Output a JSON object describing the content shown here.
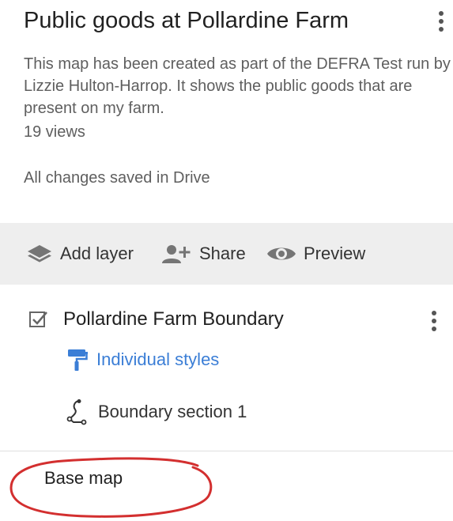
{
  "map": {
    "title": "Public goods at Pollardine Farm",
    "description": "This map has been created as part of the DEFRA Test run by Lizzie Hulton-Harrop. It shows the public goods that are present on my farm.",
    "views": "19 views",
    "save_status": "All changes saved in Drive"
  },
  "toolbar": {
    "add_layer": "Add layer",
    "share": "Share",
    "preview": "Preview"
  },
  "layer": {
    "name": "Pollardine Farm Boundary",
    "checked": true,
    "style_link": "Individual styles",
    "features": [
      {
        "label": "Boundary section 1",
        "icon": "line-path-icon"
      }
    ]
  },
  "base_map": {
    "label": "Base map"
  },
  "colors": {
    "accent": "#3b7ed6",
    "annotation": "#d32f2f",
    "toolbar_bg": "#eeeeee"
  }
}
